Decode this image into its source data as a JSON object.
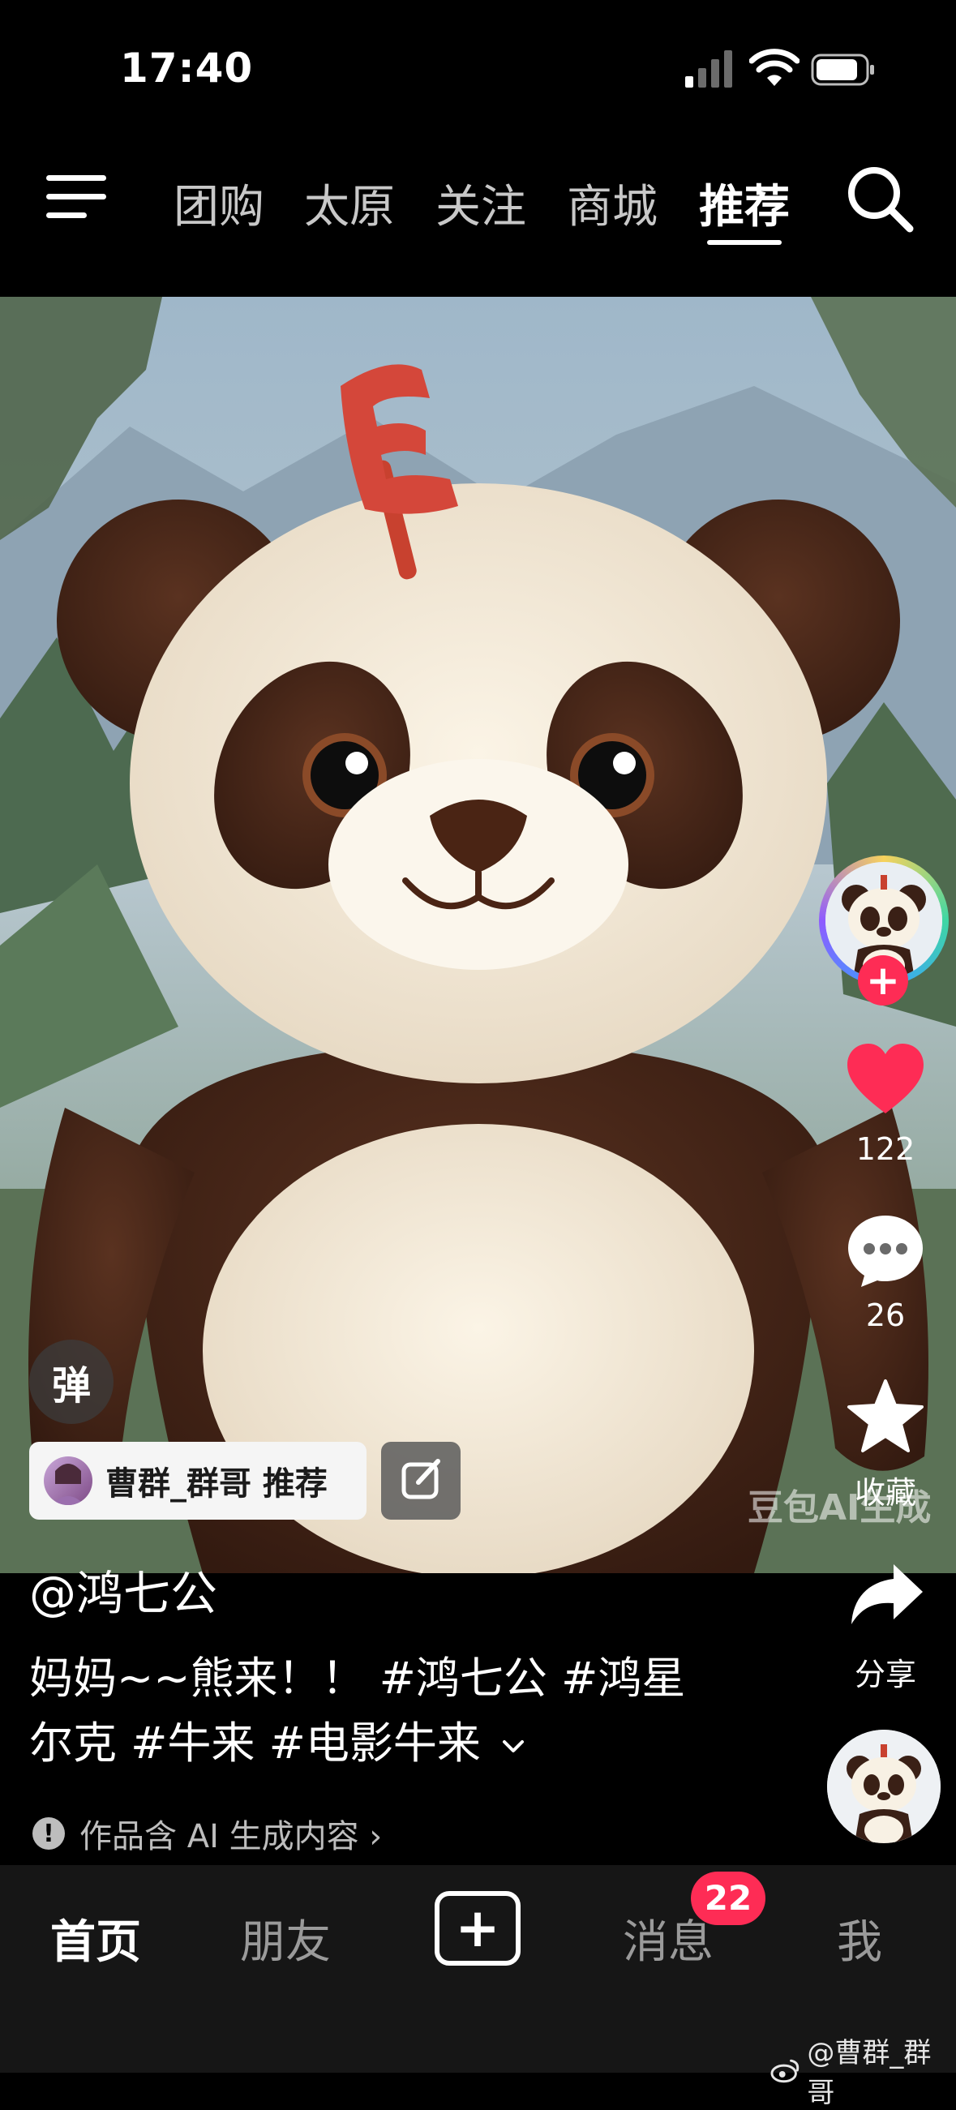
{
  "status_bar": {
    "time": "17:40"
  },
  "top_nav": {
    "tabs": [
      {
        "label": "团购"
      },
      {
        "label": "太原"
      },
      {
        "label": "关注"
      },
      {
        "label": "商城"
      },
      {
        "label": "推荐",
        "active": true
      }
    ]
  },
  "video": {
    "watermark": "豆包AI生成"
  },
  "actions": {
    "follow": "+",
    "like_count": "122",
    "comment_count": "26",
    "favorite_label": "收藏",
    "share_label": "分享"
  },
  "overlay": {
    "danmaku_label": "弹",
    "recommend_chip": "曹群_群哥 推荐"
  },
  "post": {
    "author": "@鸿七公",
    "caption_line1": "妈妈~~熊来！！ #鸿七公 #鸿星",
    "caption_line2": "尔克 #牛来 #电影牛来",
    "ai_notice": "作品含 AI 生成内容 ›"
  },
  "tabbar": {
    "home": "首页",
    "friends": "朋友",
    "create": "+",
    "messages": "消息",
    "messages_badge": "22",
    "me": "我"
  },
  "watermark": "@曹群_群哥",
  "colors": {
    "accent": "#fe2c55",
    "background": "#000000",
    "tabbar": "#161616"
  }
}
